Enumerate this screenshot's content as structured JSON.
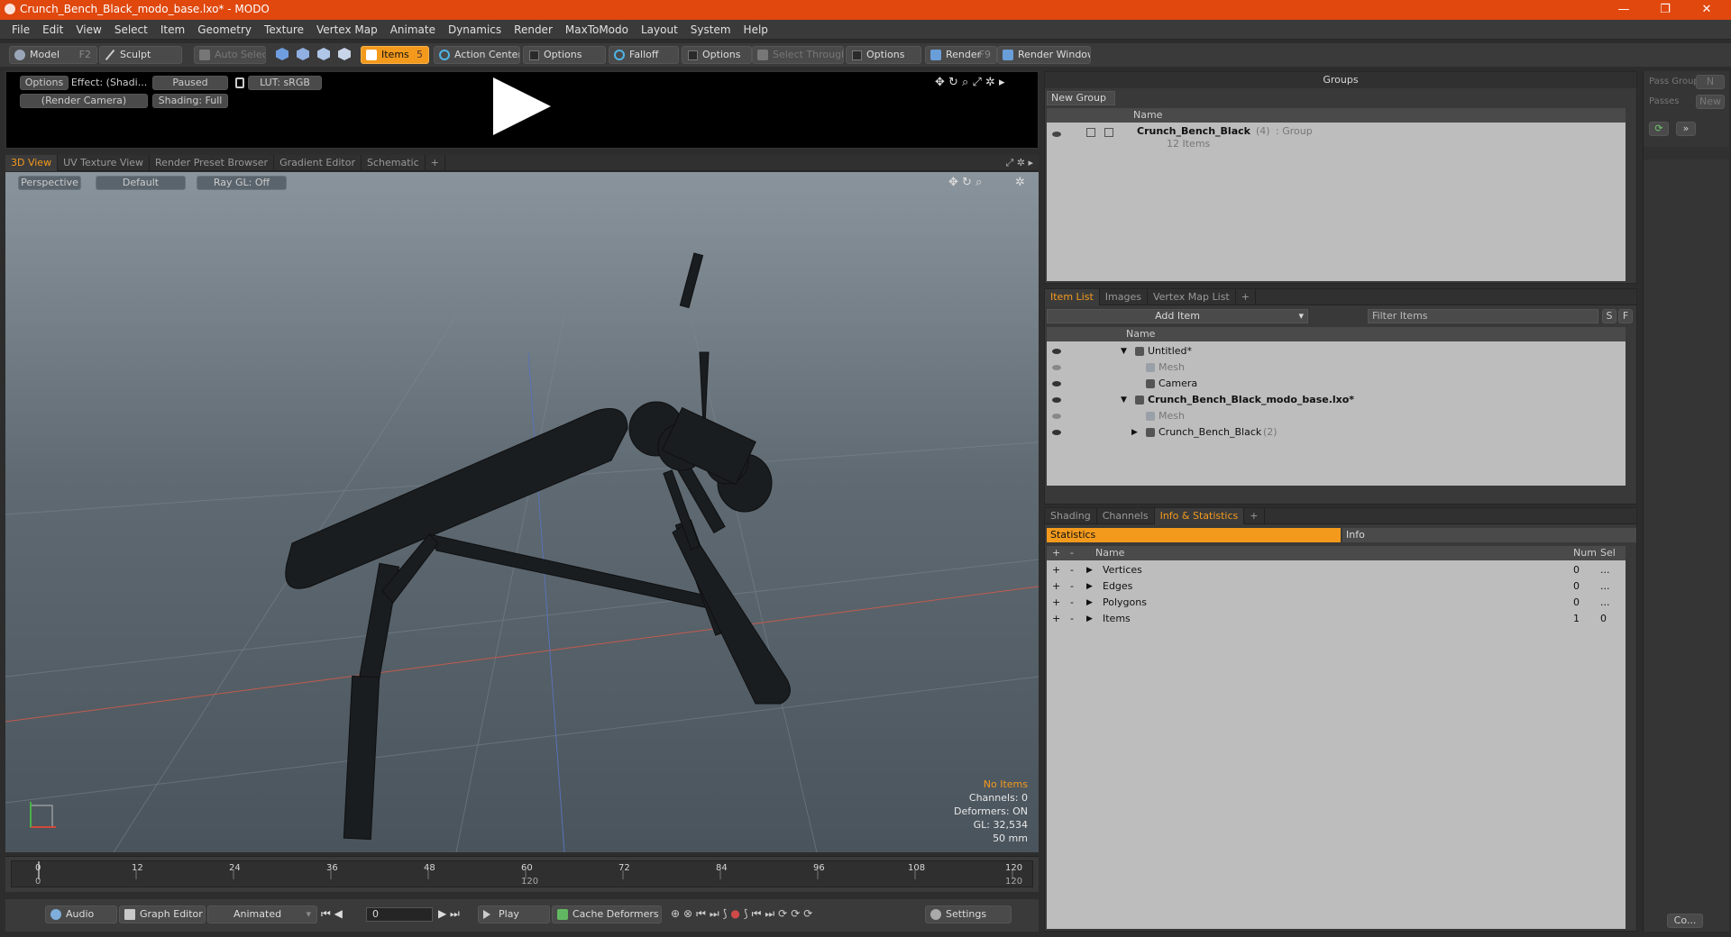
{
  "window": {
    "title": "Crunch_Bench_Black_modo_base.lxo* - MODO",
    "minimize": "—",
    "maximize": "❐",
    "close": "✕"
  },
  "menu": [
    "File",
    "Edit",
    "View",
    "Select",
    "Item",
    "Geometry",
    "Texture",
    "Vertex Map",
    "Animate",
    "Dynamics",
    "Render",
    "MaxToModo",
    "Layout",
    "System",
    "Help"
  ],
  "toolbar": {
    "model": "Model",
    "model_key": "F2",
    "sculpt": "Sculpt",
    "auto_select": "Auto Select",
    "items": "Items",
    "items_key": "5",
    "action_center": "Action Center",
    "options1": "Options",
    "falloff": "Falloff",
    "options2": "Options",
    "select_through": "Select Through",
    "options3": "Options",
    "render": "Render",
    "render_key": "F9",
    "render_window": "Render Window"
  },
  "preview": {
    "options": "Options",
    "effect": "Effect: (Shadi...",
    "paused": "Paused",
    "lut": "LUT: sRGB",
    "camera": "(Render Camera)",
    "shading": "Shading: Full"
  },
  "viewport_tabs": [
    "3D View",
    "UV Texture View",
    "Render Preset Browser",
    "Gradient Editor",
    "Schematic",
    "+"
  ],
  "viewport": {
    "perspective": "Perspective",
    "default": "Default",
    "raygl": "Ray GL: Off",
    "info": {
      "no_items": "No Items",
      "channels": "Channels: 0",
      "deformers": "Deformers: ON",
      "gl": "GL: 32,534",
      "mm": "50 mm"
    }
  },
  "timeline": {
    "ticks": [
      "0",
      "12",
      "24",
      "36",
      "48",
      "60",
      "72",
      "84",
      "96",
      "108",
      "120"
    ],
    "range_start": "0",
    "range_mid": "120",
    "range_end": "120"
  },
  "bottombar": {
    "audio": "Audio",
    "graph_editor": "Graph Editor",
    "animated": "Animated",
    "frame": "0",
    "play": "Play",
    "cache_deformers": "Cache Deformers",
    "settings": "Settings"
  },
  "groups": {
    "title": "Groups",
    "new_group": "New Group",
    "col_name": "Name",
    "item_name": "Crunch_Bench_Black",
    "item_count": "(4)",
    "item_type": ": Group",
    "item_sub": "12 Items"
  },
  "passes": {
    "pass_groups": "Pass Groups",
    "n": "N",
    "passes": "Passes",
    "new": "New",
    "co": "Co..."
  },
  "itemlist": {
    "tabs": [
      "Item List",
      "Images",
      "Vertex Map List",
      "+"
    ],
    "add_item": "Add Item",
    "filter": "Filter Items",
    "s": "S",
    "f": "F",
    "col_name": "Name",
    "rows": [
      {
        "label": "Untitled*",
        "indent": 0,
        "bold": false,
        "arrow": "▼",
        "dim": false
      },
      {
        "label": "Mesh",
        "indent": 1,
        "bold": false,
        "arrow": "",
        "dim": true
      },
      {
        "label": "Camera",
        "indent": 1,
        "bold": false,
        "arrow": "",
        "dim": false
      },
      {
        "label": "Crunch_Bench_Black_modo_base.lxo*",
        "indent": 0,
        "bold": true,
        "arrow": "▼",
        "dim": false
      },
      {
        "label": "Mesh",
        "indent": 1,
        "bold": false,
        "arrow": "",
        "dim": true
      },
      {
        "label": "Crunch_Bench_Black",
        "indent": 1,
        "bold": false,
        "arrow": "▶",
        "dim": false,
        "suffix": "(2)"
      }
    ]
  },
  "stats": {
    "tabs": [
      "Shading",
      "Channels",
      "Info & Statistics",
      "+"
    ],
    "statistics": "Statistics",
    "info": "Info",
    "col_name": "Name",
    "col_num": "Num",
    "col_sel": "Sel",
    "rows": [
      {
        "name": "Vertices",
        "num": "0",
        "sel": "..."
      },
      {
        "name": "Edges",
        "num": "0",
        "sel": "..."
      },
      {
        "name": "Polygons",
        "num": "0",
        "sel": "..."
      },
      {
        "name": "Items",
        "num": "1",
        "sel": "0"
      }
    ]
  },
  "colors": {
    "accent": "#f39a1d",
    "title": "#e0480e"
  }
}
